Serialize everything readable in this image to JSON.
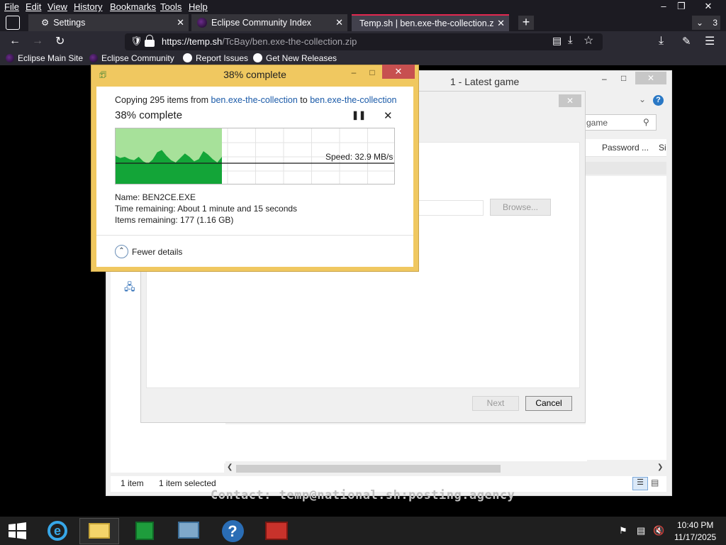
{
  "firefox": {
    "menu": [
      "File",
      "Edit",
      "View",
      "History",
      "Bookmarks",
      "Tools",
      "Help"
    ],
    "tabs": [
      {
        "label": "Settings"
      },
      {
        "label": "Eclipse Community Index"
      },
      {
        "label": "Temp.sh | ben.exe-the-collection.zip"
      }
    ],
    "tab_count": "3",
    "url_host": "https://temp.sh",
    "url_path": "/TcBay/ben.exe-the-collection.zip",
    "bookmarks": [
      "Eclipse Main Site",
      "Eclipse Community",
      "Report Issues",
      "Get New Releases"
    ]
  },
  "explorer": {
    "title": "1 - Latest game",
    "search_placeholder": "game",
    "column_password": "Password ...",
    "column_size": "Si",
    "status_items": "1 item",
    "status_selected": "1 item selected"
  },
  "wizard": {
    "browse_label": "Browse...",
    "next_label": "Next",
    "cancel_label": "Cancel"
  },
  "copy": {
    "title": "38% complete",
    "copying_prefix": "Copying 295 items from",
    "from": "ben.exe-the-collection",
    "to_word": "to",
    "to": "ben.exe-the-collection",
    "percent_text": "38% complete",
    "progress": 0.38,
    "speed": "Speed: 32.9 MB/s",
    "name": "Name:  BEN2CE.EXE",
    "time_remaining": "Time remaining:  About 1 minute and 15 seconds",
    "items_remaining": "Items remaining:  177 (1.16 GB)",
    "details_toggle": "Fewer details"
  },
  "overlay_text": "Contact: temp@national.sh:posting.agency",
  "taskbar": {
    "time": "10:40 PM",
    "date": "11/17/2025"
  },
  "colors": {
    "progress_fill": "#a7e19a",
    "graph_fill": "#13a538",
    "accent_tab": "#e22850"
  }
}
